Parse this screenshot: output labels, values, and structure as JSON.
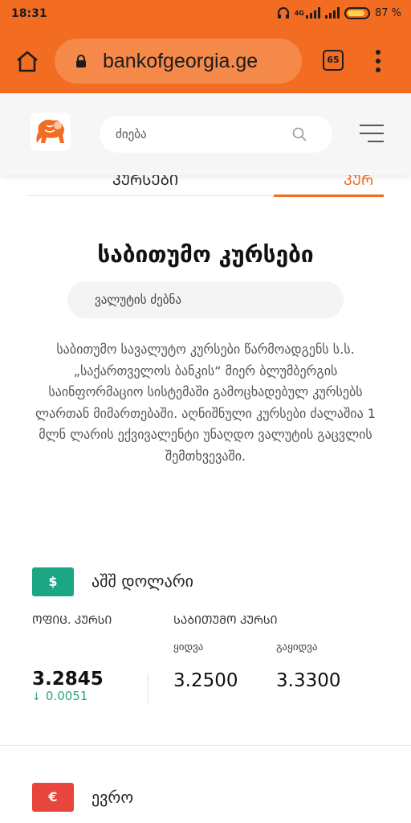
{
  "status_bar": {
    "time": "18:31",
    "network": "4G",
    "battery_percent": "87 %",
    "icons": [
      "headphones-icon",
      "signal-icon",
      "battery-icon"
    ]
  },
  "browser": {
    "url": "bankofgeorgia.ge",
    "tab_count": "65",
    "icons": [
      "home-icon",
      "lock-icon",
      "tabs-icon",
      "overflow-menu-icon"
    ]
  },
  "header": {
    "logo_icon": "lion-logo-icon",
    "search_placeholder": "ძიება",
    "search_icon": "search-icon",
    "menu_icon": "hamburger-menu-icon"
  },
  "tabs": [
    {
      "label": "ᲙᲣᲠᲡᲔᲑᲘ",
      "active": false
    },
    {
      "label": "ᲙᲣᲠ",
      "active": true
    }
  ],
  "page": {
    "title": "საბითუმო კურსები",
    "currency_search": "ვალუტის ძებნა",
    "description": "საბითუმო სავალუტო კურსები წარმოადგენს ს.ს. „საქართველოს ბანკის“ მიერ ბლუმბერგის საინფორმაციო სისტემაში გამოცხადებულ კურსებს ლართან მიმართებაში. აღნიშნული კურსები ძალაშია 1 მლნ ლარის ექვივალენტი უნაღდო ვალუტის გაცვლის შემთხვევაში."
  },
  "currencies": [
    {
      "symbol": "$",
      "name": "აშშ დოლარი",
      "badge_color": "#1ba784",
      "official_label": "ᲝᲤᲘᲪ. ᲙᲣᲠᲡᲘ",
      "wholesale_label": "ᲡᲐᲑᲘᲗᲣᲛᲝ ᲙᲣᲠᲡᲘ",
      "buy_label": "ყიდვა",
      "sell_label": "გაყიდვა",
      "official_rate": "3.2845",
      "change_arrow": "↓",
      "change": "0.0051",
      "buy": "3.2500",
      "sell": "3.3300"
    },
    {
      "symbol": "€",
      "name": "ევრო",
      "badge_color": "#e8453c"
    }
  ],
  "colors": {
    "accent": "#f26c22",
    "positive": "#2aa383"
  }
}
